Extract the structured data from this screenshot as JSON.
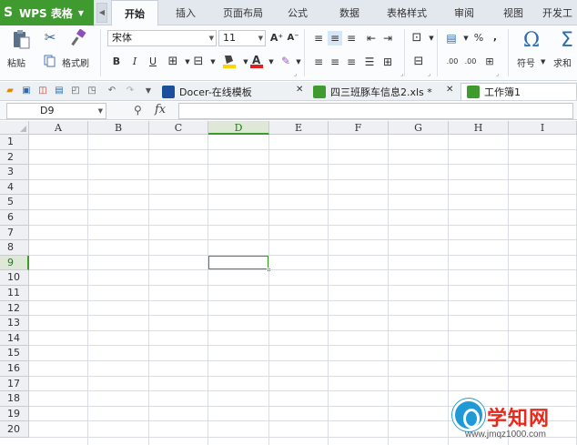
{
  "app": {
    "title": "WPS 表格",
    "logo_letter": "S",
    "brand_color": "#3f9b2f"
  },
  "ribbon_tabs": [
    {
      "label": "开始",
      "active": true
    },
    {
      "label": "插入"
    },
    {
      "label": "页面布局"
    },
    {
      "label": "公式"
    },
    {
      "label": "数据"
    },
    {
      "label": "表格样式"
    },
    {
      "label": "审阅"
    },
    {
      "label": "视图"
    },
    {
      "label": "开发工"
    }
  ],
  "ribbon": {
    "paste_label": "粘贴",
    "format_painter_label": "格式刷",
    "font_name": "宋体",
    "font_size": "11",
    "symbol_label": "符号",
    "sum_label": "求和",
    "percent": "%",
    "comma": ",",
    "increase_font": "A⁺",
    "decrease_font": "A⁻",
    "bold": "B",
    "italic": "I",
    "underline": "U",
    "omega": "Ω",
    "sigma": "Σ",
    "dec_inc": ".00",
    "dec_dec": ".00"
  },
  "doc_tabs": [
    {
      "label": "Docer-在线模板",
      "icon_color": "#1b4f9c"
    },
    {
      "label": "四三班豚车信息2.xls *",
      "icon_color": "#3f9b2f"
    },
    {
      "label": "工作簿1",
      "icon_color": "#3f9b2f",
      "active": true
    }
  ],
  "formula_bar": {
    "name_box": "D9",
    "fx": "fx",
    "formula": ""
  },
  "grid": {
    "columns": [
      "A",
      "B",
      "C",
      "D",
      "E",
      "F",
      "G",
      "H",
      "I"
    ],
    "rows": [
      "1",
      "2",
      "3",
      "4",
      "5",
      "6",
      "7",
      "8",
      "9",
      "10",
      "11",
      "12",
      "13",
      "14",
      "15",
      "16",
      "17",
      "18",
      "19",
      "20"
    ],
    "active_cell": "D9",
    "active_col": "D",
    "active_row": "9"
  },
  "watermark": {
    "text": "学知网",
    "url": "www.jmqz1000.com"
  }
}
